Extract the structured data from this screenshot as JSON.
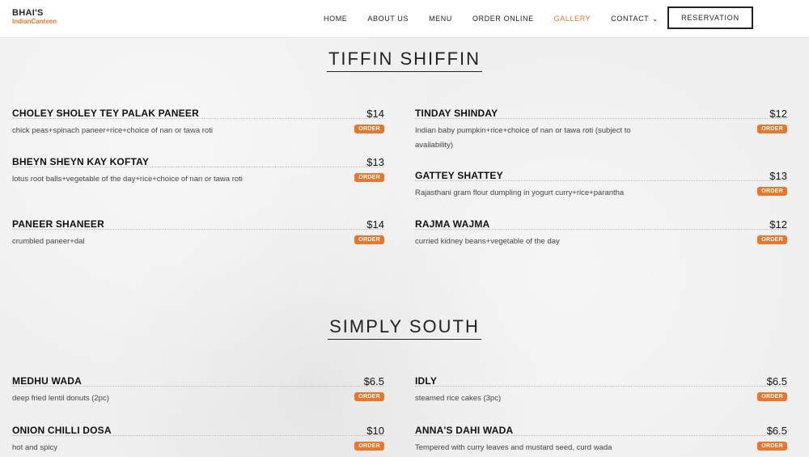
{
  "logo": {
    "line1": "BHAI'S",
    "line2": "IndianCanteen"
  },
  "nav": {
    "home": "HOME",
    "about": "ABOUT US",
    "menu": "MENU",
    "order_online": "ORDER ONLINE",
    "gallery": "GALLERY",
    "contact": "CONTACT",
    "reservation": "RESERVATION"
  },
  "colors": {
    "accent": "#e8762b",
    "text": "#222222",
    "background": "#efefef"
  },
  "order_label": "ORDER",
  "sections": [
    {
      "title": "TIFFIN SHIFFIN",
      "items": [
        {
          "name": "CHOLEY SHOLEY TEY PALAK PANEER",
          "price": "$14",
          "desc": "chick peas+spinach paneer+rice+choice of nan or tawa roti"
        },
        {
          "name": "TINDAY SHINDAY",
          "price": "$12",
          "desc": "Indian baby pumpkin+rice+choice of nan or tawa roti (subject to availability)"
        },
        {
          "name": "BHEYN SHEYN KAY KOFTAY",
          "price": "$13",
          "desc": "lotus root balls+vegetable of the day+rice+choice of nan or tawa roti"
        },
        {
          "name": "GATTEY SHATTEY",
          "price": "$13",
          "desc": "Rajasthani gram flour dumpling in yogurt curry+rice+parantha"
        },
        {
          "name": "PANEER SHANEER",
          "price": "$14",
          "desc": "crumbled paneer+dal"
        },
        {
          "name": "RAJMA WAJMA",
          "price": "$12",
          "desc": "curried kidney beans+vegetable of the day"
        }
      ]
    },
    {
      "title": "SIMPLY SOUTH",
      "items": [
        {
          "name": "MEDHU WADA",
          "price": "$6.5",
          "desc": "deep fried lentil donuts (2pc)"
        },
        {
          "name": "IDLY",
          "price": "$6.5",
          "desc": "steamed rice cakes (3pc)"
        },
        {
          "name": "ONION CHILLI DOSA",
          "price": "$10",
          "desc": "hot and spicy"
        },
        {
          "name": "ANNA'S DAHI WADA",
          "price": "$6.5",
          "desc": "Tempered with curry leaves and mustard seed, curd wada"
        }
      ]
    }
  ]
}
